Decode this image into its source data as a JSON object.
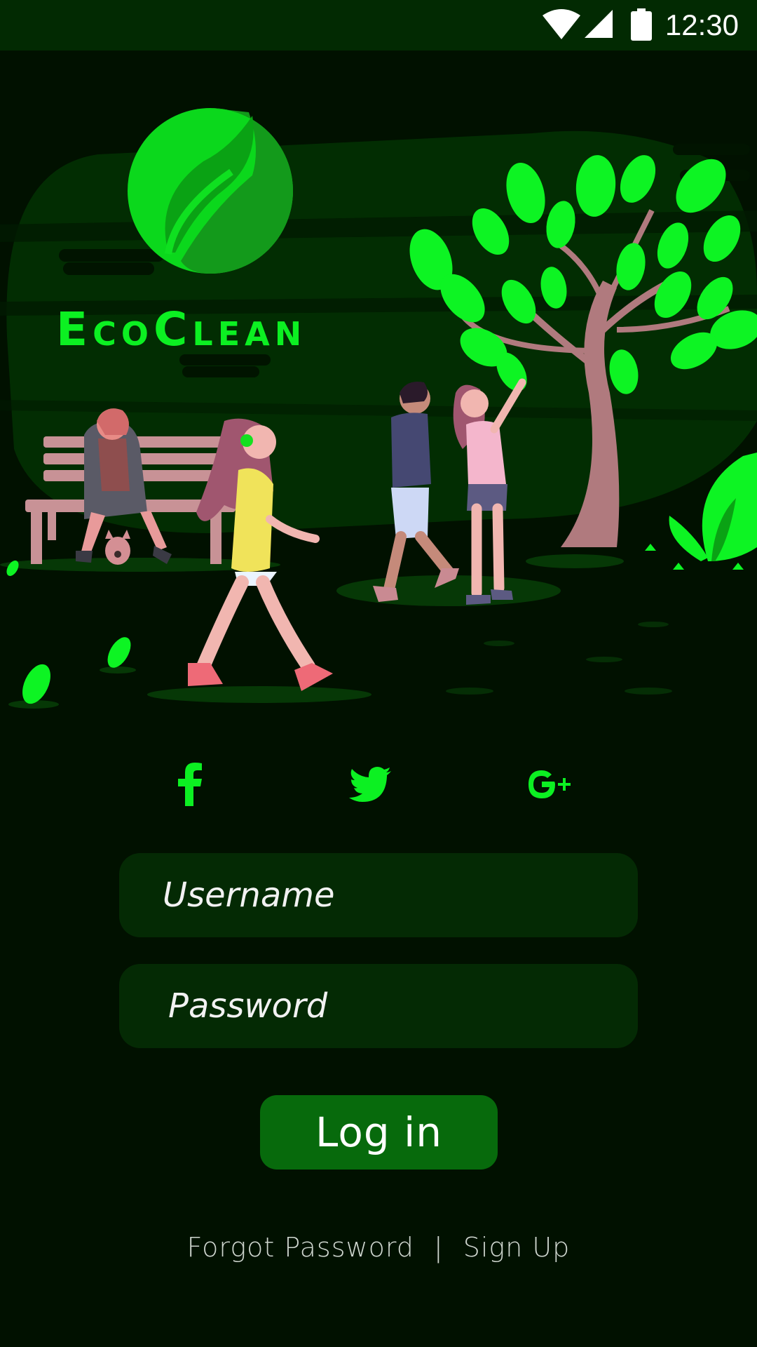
{
  "status_bar": {
    "time": "12:30",
    "icons": [
      "wifi-icon",
      "cellular-signal-icon",
      "battery-icon"
    ]
  },
  "app": {
    "name": "EcoClean",
    "logo": "leaf-circle-logo"
  },
  "social": [
    {
      "name": "facebook",
      "icon": "facebook-icon"
    },
    {
      "name": "twitter",
      "icon": "twitter-icon"
    },
    {
      "name": "google-plus",
      "icon": "google-plus-icon"
    }
  ],
  "form": {
    "username_placeholder": "Username",
    "password_placeholder": "Password",
    "login_label": "Log in"
  },
  "footer": {
    "forgot_password": "Forgot Password",
    "separator": "|",
    "sign_up": "Sign Up"
  },
  "colors": {
    "background": "#011100",
    "status_bar": "#022a02",
    "accent": "#0cf022",
    "field_bg": "#042a04",
    "button_bg": "#076a0c"
  }
}
